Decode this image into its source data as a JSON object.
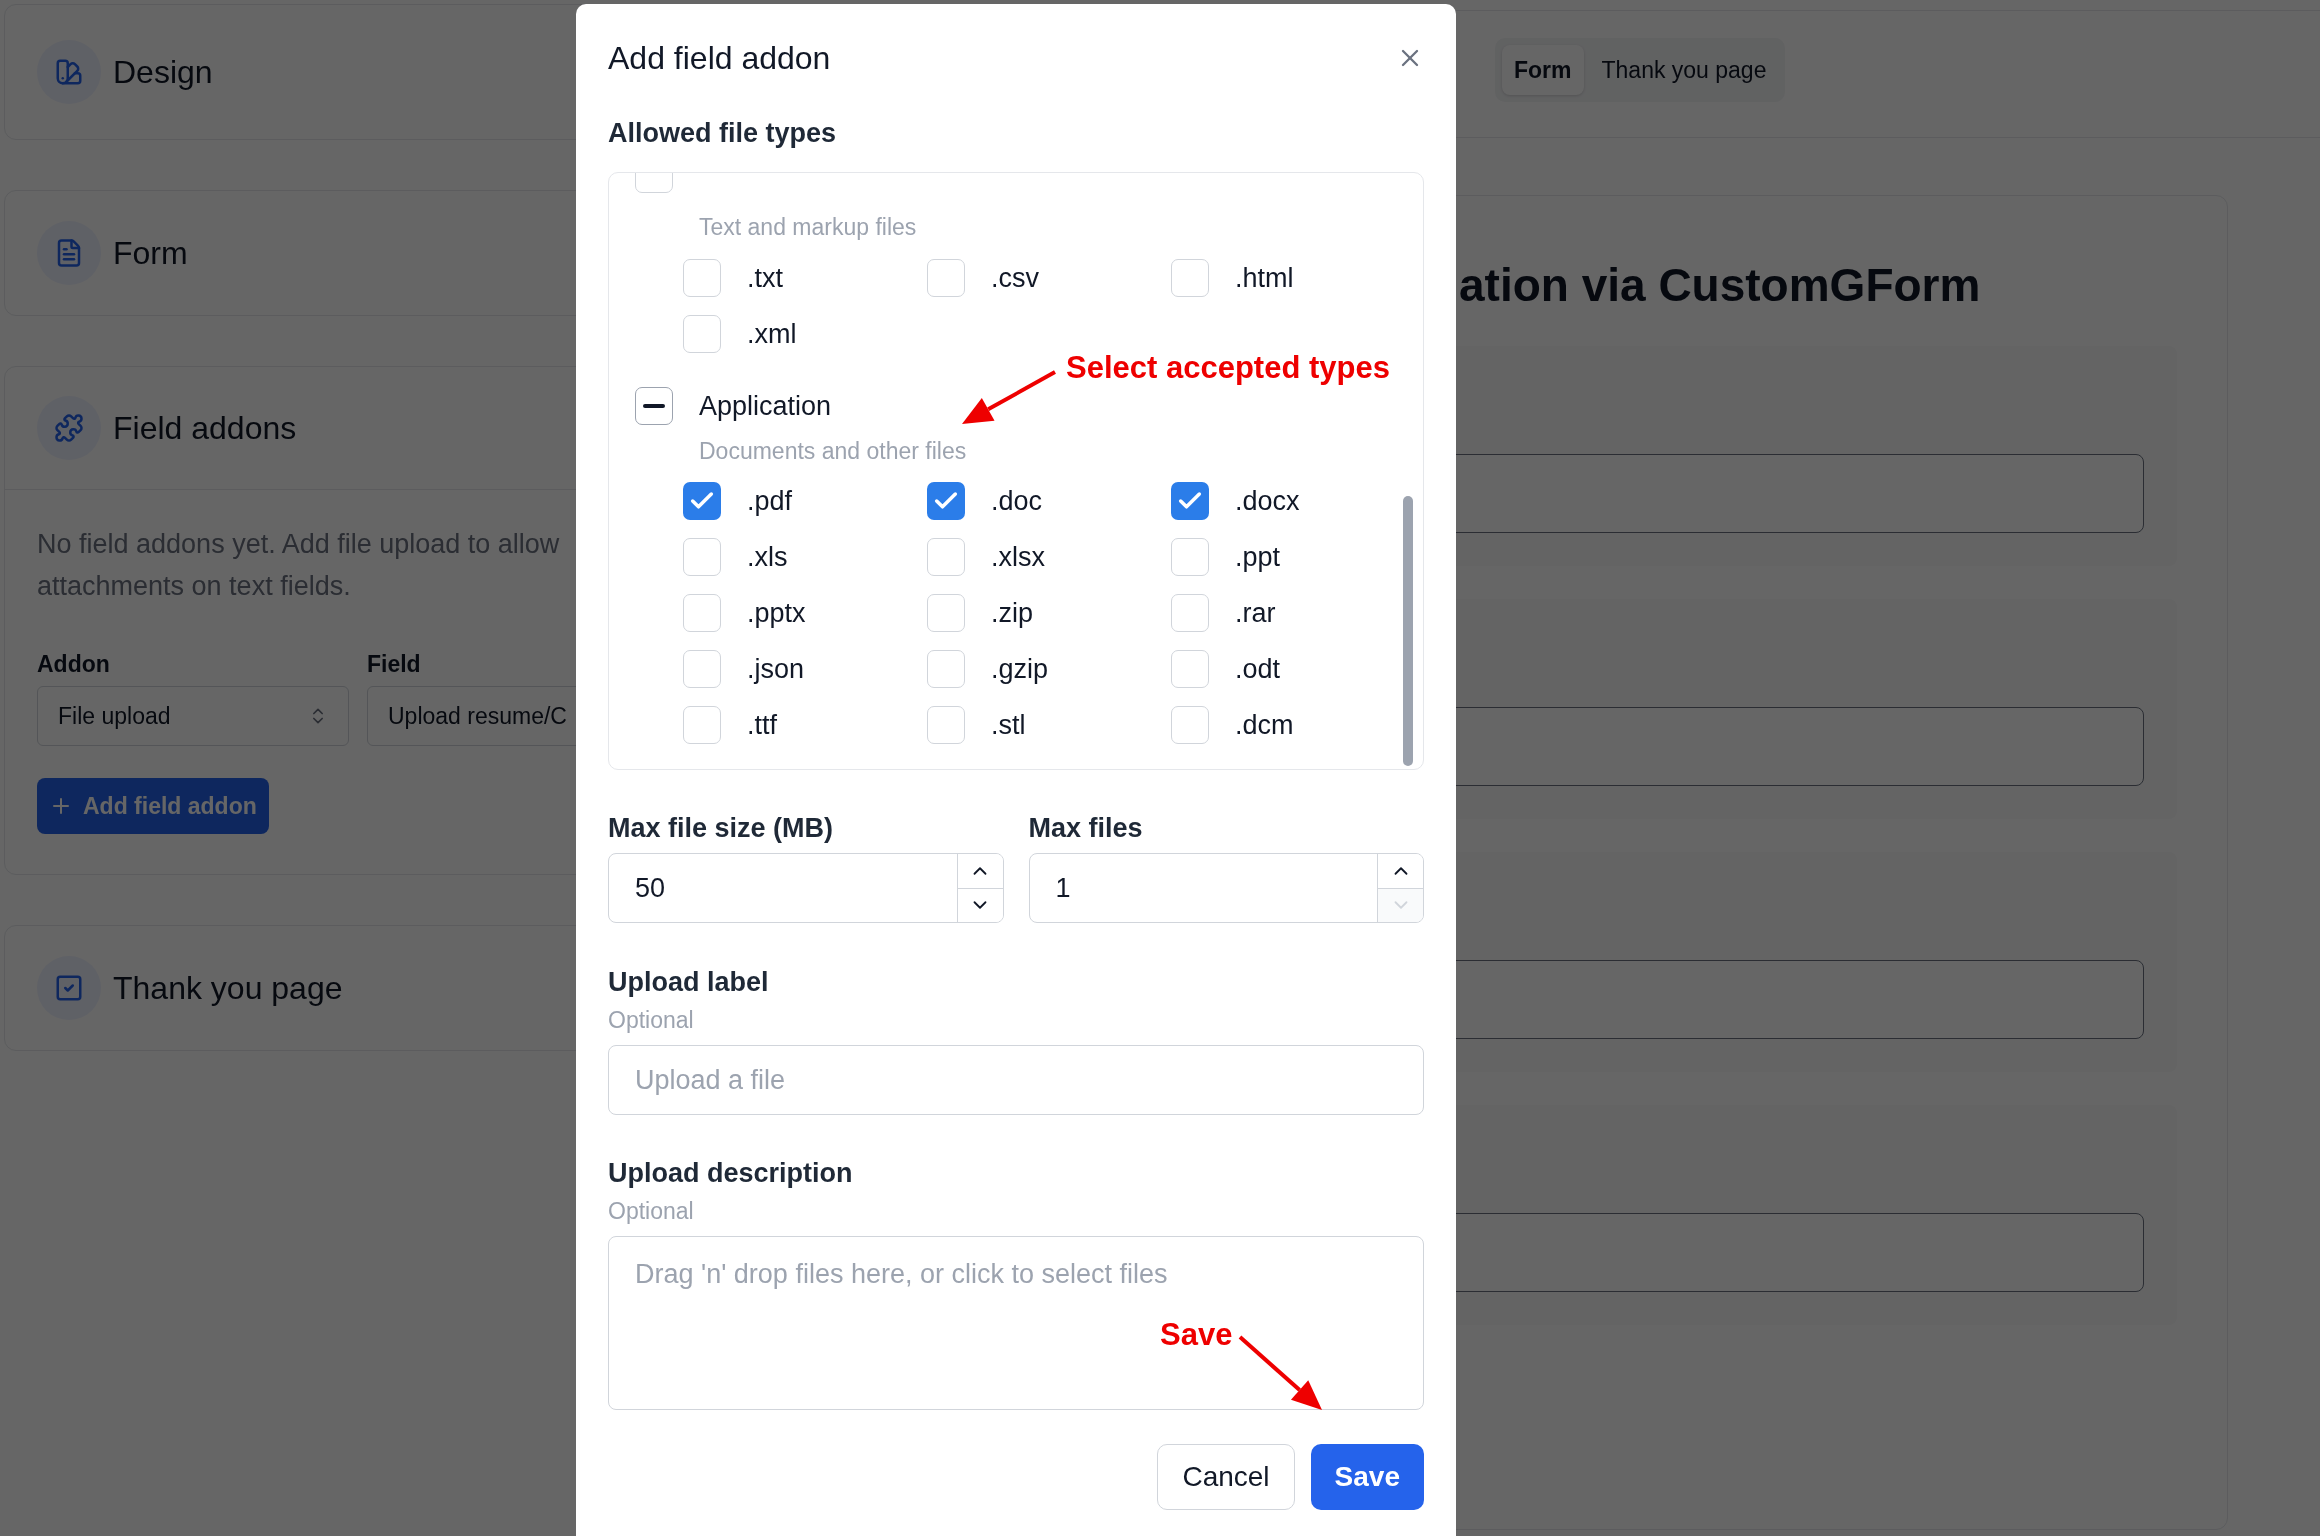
{
  "sections": [
    {
      "kind": "swatch",
      "title": "Design"
    },
    {
      "kind": "document",
      "title": "Form"
    },
    {
      "kind": "puzzle",
      "title": "Field addons",
      "body": {
        "description": "No field addons yet. Add file upload to allow attachments on text fields.",
        "addon_label": "Addon",
        "addon_value": "File upload",
        "field_label": "Field",
        "field_value": "Upload resume/C",
        "button": "Add field addon"
      }
    },
    {
      "kind": "check-square",
      "title": "Thank you page"
    }
  ],
  "top_tabs": [
    {
      "label": "Form",
      "selected": true
    },
    {
      "label": "Thank you page",
      "selected": false
    }
  ],
  "preview": {
    "title": "ation via CustomGForm"
  },
  "modal": {
    "title": "Add field addon",
    "section_title": "Allowed file types",
    "groups": [
      {
        "header_checked": false,
        "description": "Text and markup files",
        "options": [
          {
            "label": ".txt",
            "checked": false
          },
          {
            "label": ".csv",
            "checked": false
          },
          {
            "label": ".html",
            "checked": false
          },
          {
            "label": ".xml",
            "checked": false
          }
        ]
      },
      {
        "title": "Application",
        "indeterminate": true,
        "description": "Documents and other files",
        "options": [
          {
            "label": ".pdf",
            "checked": true
          },
          {
            "label": ".doc",
            "checked": true
          },
          {
            "label": ".docx",
            "checked": true
          },
          {
            "label": ".xls",
            "checked": false
          },
          {
            "label": ".xlsx",
            "checked": false
          },
          {
            "label": ".ppt",
            "checked": false
          },
          {
            "label": ".pptx",
            "checked": false
          },
          {
            "label": ".zip",
            "checked": false
          },
          {
            "label": ".rar",
            "checked": false
          },
          {
            "label": ".json",
            "checked": false
          },
          {
            "label": ".gzip",
            "checked": false
          },
          {
            "label": ".odt",
            "checked": false
          },
          {
            "label": ".ttf",
            "checked": false
          },
          {
            "label": ".stl",
            "checked": false
          },
          {
            "label": ".dcm",
            "checked": false
          }
        ]
      }
    ],
    "numbers": [
      {
        "label": "Max file size (MB)",
        "value": "50",
        "down_disabled": false
      },
      {
        "label": "Max files",
        "value": "1",
        "down_disabled": true
      }
    ],
    "upload_label": {
      "label": "Upload label",
      "hint": "Optional",
      "placeholder": "Upload a file"
    },
    "upload_description": {
      "label": "Upload description",
      "hint": "Optional",
      "placeholder": "Drag 'n' drop files here, or click to select files"
    },
    "buttons": [
      {
        "kind": "secondary",
        "label": "Cancel"
      },
      {
        "kind": "primary",
        "label": "Save"
      }
    ]
  },
  "annotations": [
    {
      "kind": "types",
      "text": "Select accepted types"
    },
    {
      "kind": "save",
      "text": "Save"
    }
  ]
}
